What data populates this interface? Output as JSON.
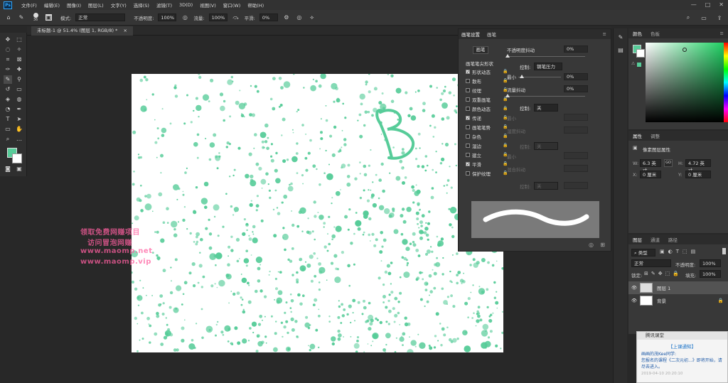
{
  "menubar": {
    "ps_label": "Ps",
    "items": [
      "文件(F)",
      "编辑(E)",
      "图像(I)",
      "图层(L)",
      "文字(Y)",
      "选择(S)",
      "滤镜(T)",
      "3D(D)",
      "视图(V)",
      "窗口(W)",
      "帮助(H)"
    ],
    "window_controls": [
      "—",
      "□",
      "✕"
    ]
  },
  "options": {
    "brush_size": "36",
    "mode_label": "模式:",
    "mode_value": "正常",
    "opacity_label": "不透明度:",
    "opacity_value": "100%",
    "flow_label": "流量:",
    "flow_value": "100%",
    "smooth_label": "平滑:",
    "smooth_value": "0%"
  },
  "document": {
    "tab_title": "未标题-1 @ 51.4% (图层 1, RGB/8) *",
    "brush_color": "#57cc99"
  },
  "brush_panel": {
    "tabs": [
      "画笔设置",
      "画笔"
    ],
    "preset_button": "画笔",
    "tip_shape": "画笔笔尖形状",
    "items": [
      {
        "label": "形状动态",
        "checked": true
      },
      {
        "label": "散布",
        "checked": false
      },
      {
        "label": "纹理",
        "checked": false
      },
      {
        "label": "双重画笔",
        "checked": false
      },
      {
        "label": "颜色动态",
        "checked": false
      },
      {
        "label": "传递",
        "checked": true
      },
      {
        "label": "画笔笔势",
        "checked": false
      },
      {
        "label": "杂色",
        "checked": false
      },
      {
        "label": "湿边",
        "checked": false
      },
      {
        "label": "建立",
        "checked": false
      },
      {
        "label": "平滑",
        "checked": true
      },
      {
        "label": "保护纹理",
        "checked": false
      }
    ],
    "opacity_jitter_label": "不透明度抖动",
    "opacity_jitter_value": "0%",
    "control_label": "控制:",
    "control_value_1": "钢笔压力",
    "min_label": "最小",
    "min_value": "0%",
    "flow_jitter_label": "流量抖动",
    "flow_jitter_value": "0%",
    "control_value_2": "关",
    "min_value_2": "",
    "wetness_jitter": "湿度抖动",
    "control_value_3": "关",
    "mix_jitter": "混合抖动",
    "control_value_4": "关"
  },
  "color_panel": {
    "tabs": [
      "颜色",
      "色板"
    ],
    "fg": "#57cc99",
    "bg": "#ffffff"
  },
  "properties": {
    "tabs": [
      "属性",
      "调整"
    ],
    "title": "像素图层属性",
    "w_label": "W:",
    "w_value": "6.3 英寸",
    "h_label": "H:",
    "h_value": "4.72 英寸",
    "x_label": "X:",
    "x_value": "0 厘米",
    "y_label": "Y:",
    "y_value": "0 厘米",
    "link_label": "GO"
  },
  "layers": {
    "tabs": [
      "图层",
      "通道",
      "路径"
    ],
    "filter_label": "类型",
    "blend_mode": "正常",
    "opacity_label": "不透明度:",
    "opacity_value": "100%",
    "lock_label": "锁定:",
    "fill_label": "填充:",
    "fill_value": "100%",
    "rows": [
      {
        "name": "图层 1",
        "selected": true
      },
      {
        "name": "背景",
        "selected": false
      }
    ]
  },
  "notification": {
    "header": "腾讯课堂",
    "title": "【上课通知】",
    "body": "画画的茂Kee同学:\n您报名的课程《二次元初...》即将开始，请尽去进入。",
    "stamp": "2019-04-10 20:20:10"
  },
  "watermark": {
    "line1": "领取免费网赚项目",
    "line2": "访问冒泡网赚",
    "line3": "www.maomp.net",
    "line4": "www.maomp.vip"
  }
}
